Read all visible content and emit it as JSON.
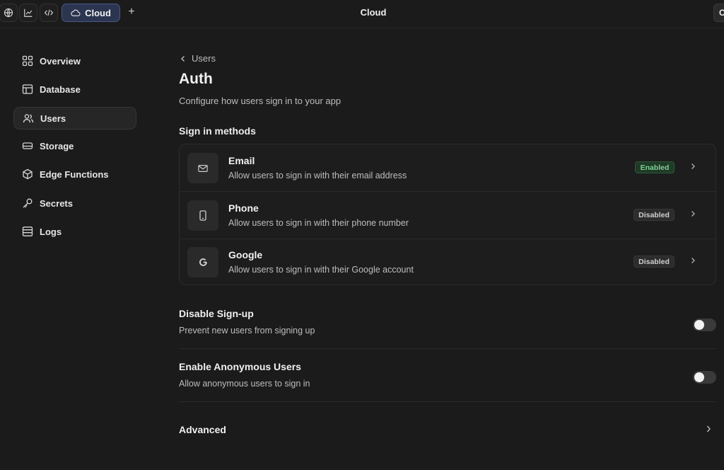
{
  "topbar": {
    "cloud_label": "Cloud",
    "title": "Cloud",
    "plus": "+",
    "right_label": "C"
  },
  "sidebar": {
    "items": [
      {
        "label": "Overview",
        "icon": "grid-icon",
        "active": false
      },
      {
        "label": "Database",
        "icon": "table-icon",
        "active": false
      },
      {
        "label": "Users",
        "icon": "users-icon",
        "active": true
      },
      {
        "label": "Storage",
        "icon": "storage-icon",
        "active": false
      },
      {
        "label": "Edge Functions",
        "icon": "cube-icon",
        "active": false
      },
      {
        "label": "Secrets",
        "icon": "key-icon",
        "active": false
      },
      {
        "label": "Logs",
        "icon": "logs-icon",
        "active": false
      }
    ]
  },
  "main": {
    "breadcrumb": "Users",
    "title": "Auth",
    "subtitle": "Configure how users sign in to your app",
    "sign_in_heading": "Sign in methods",
    "methods": [
      {
        "name": "Email",
        "description": "Allow users to sign in with their email address",
        "status": "Enabled",
        "icon": "mail-icon"
      },
      {
        "name": "Phone",
        "description": "Allow users to sign in with their phone number",
        "status": "Disabled",
        "icon": "phone-icon"
      },
      {
        "name": "Google",
        "description": "Allow users to sign in with their Google account",
        "status": "Disabled",
        "icon": "google-icon"
      }
    ],
    "disable_signup": {
      "title": "Disable Sign-up",
      "description": "Prevent new users from signing up",
      "enabled": false
    },
    "anonymous_users": {
      "title": "Enable Anonymous Users",
      "description": "Allow anonymous users to sign in",
      "enabled": false
    },
    "advanced": "Advanced"
  },
  "colors": {
    "background": "#1b1b1b",
    "accent_cloud": "#2b3550",
    "enabled_badge": "#7fd095"
  }
}
